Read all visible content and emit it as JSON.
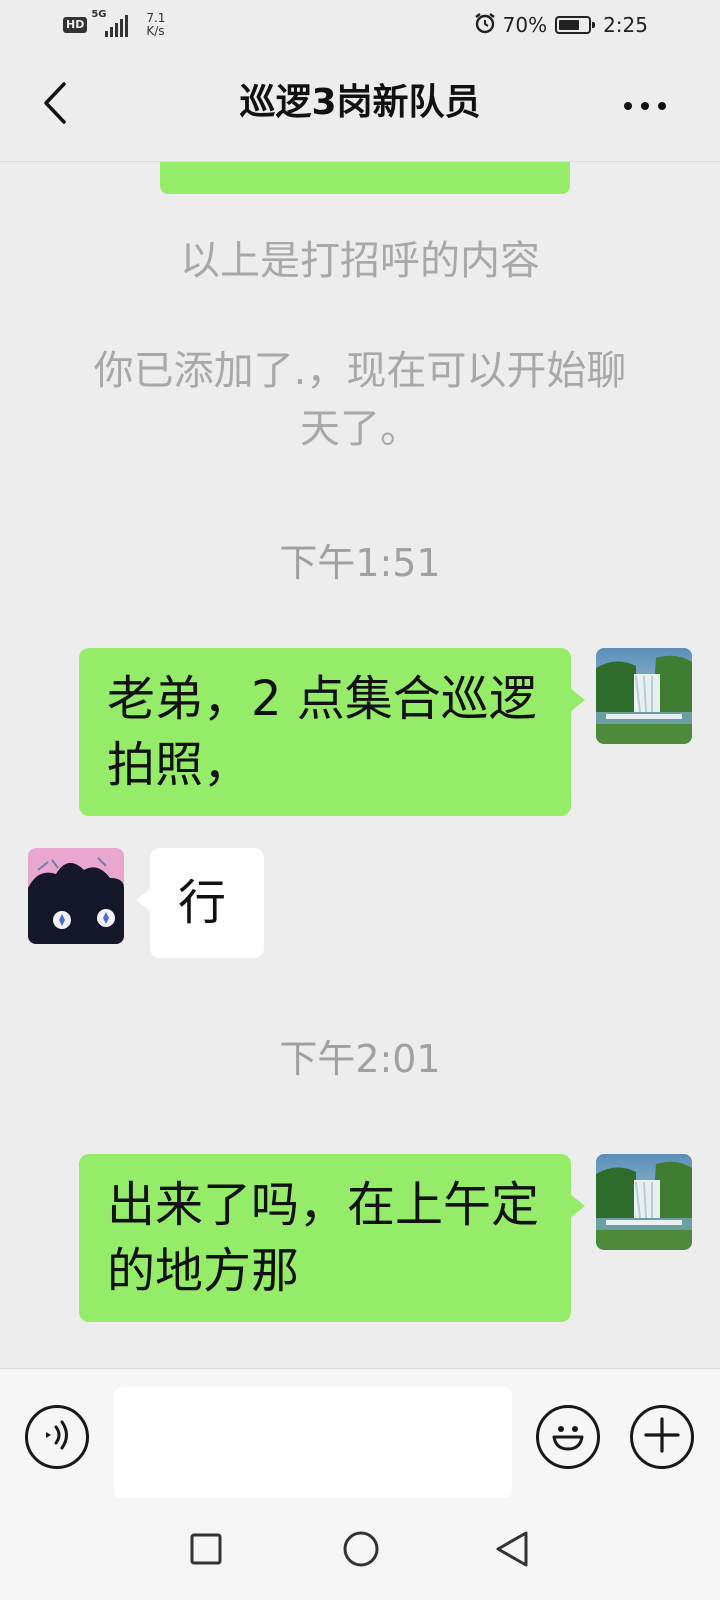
{
  "status_bar": {
    "hd_badge": "HD",
    "network_type": "5G",
    "net_speed_value": "7.1",
    "net_speed_unit": "K/s",
    "battery_percent": "70%",
    "battery_level": 0.7,
    "time": "2:25"
  },
  "header": {
    "title": "巡逻3岗新队员"
  },
  "chat": {
    "system_messages": [
      "以上是打招呼的内容",
      "你已添加了.，现在可以开始聊天了。"
    ],
    "timestamps": [
      "下午1:51",
      "下午2:01"
    ],
    "messages": [
      {
        "from": "me",
        "text": "老弟，2 点集合巡逻拍照，"
      },
      {
        "from": "other",
        "text": "行"
      },
      {
        "from": "me",
        "text": "出来了吗，在上午定的地方那"
      }
    ]
  },
  "icons": {
    "back": "chevron-left-icon",
    "more": "more-dots-icon",
    "voice": "voice-icon",
    "emoji": "emoji-icon",
    "add": "plus-icon",
    "nav_recent": "square-icon",
    "nav_home": "circle-icon",
    "nav_back": "triangle-back-icon"
  },
  "colors": {
    "sent_bubble": "#95ec69",
    "received_bubble": "#ffffff",
    "background": "#ededed"
  }
}
